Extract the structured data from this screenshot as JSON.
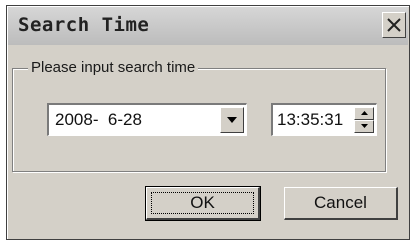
{
  "window": {
    "title": "Search Time"
  },
  "group": {
    "legend": "Please input search time"
  },
  "date_combo": {
    "value": "2008-  6-28"
  },
  "time_field": {
    "value": "13:35:31"
  },
  "buttons": {
    "ok_label": "OK",
    "cancel_label": "Cancel"
  },
  "icons": {
    "close": "close-icon",
    "dropdown": "chevron-down-icon",
    "spin_up": "triangle-up-icon",
    "spin_down": "triangle-down-icon"
  }
}
